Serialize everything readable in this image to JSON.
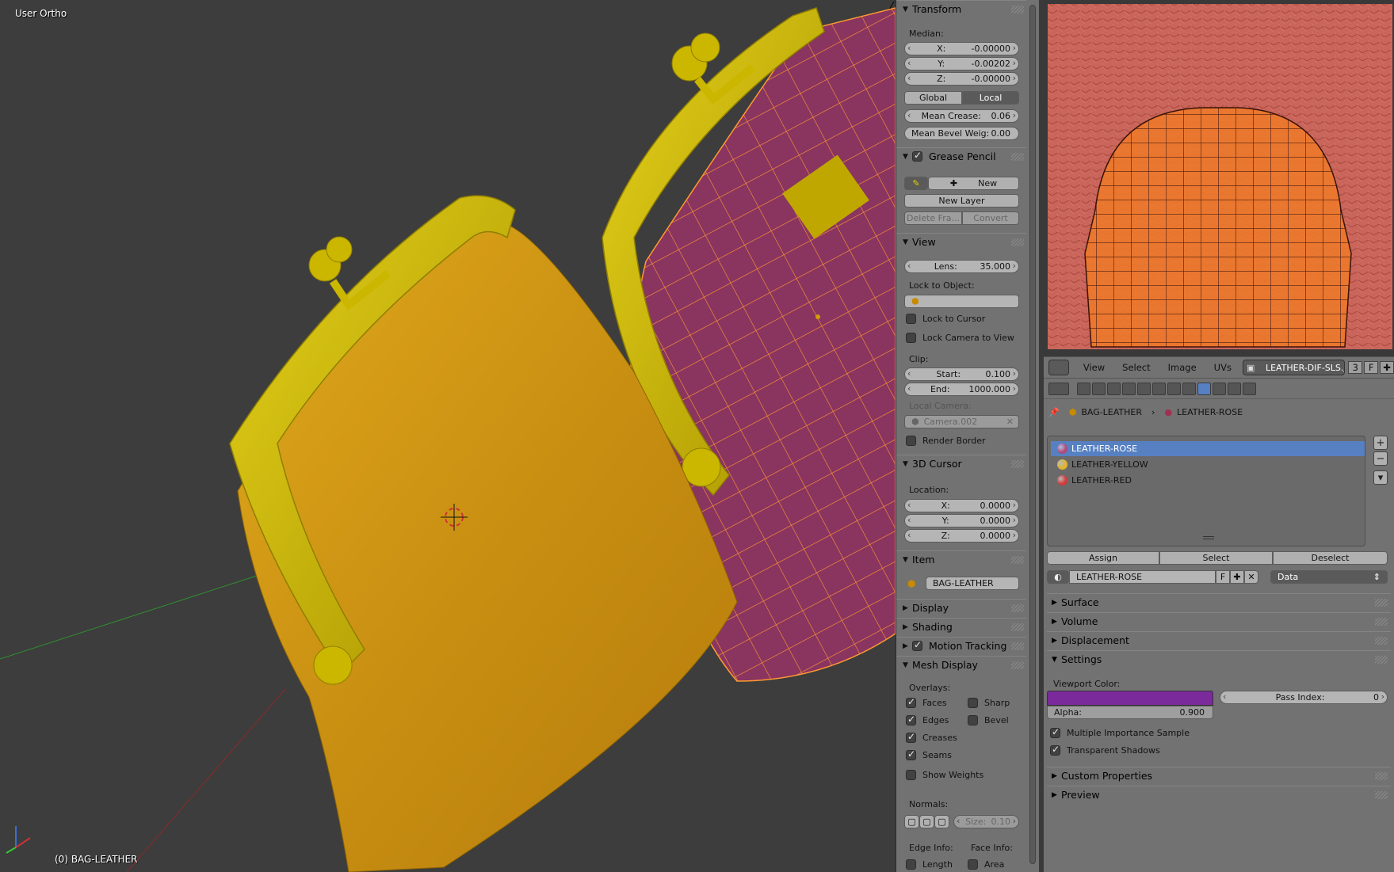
{
  "viewport": {
    "view_label": "User Ortho",
    "active_object_label": "(0) BAG-LEATHER"
  },
  "npanel": {
    "transform": {
      "title": "Transform",
      "median_label": "Median:",
      "x_label": "X:",
      "x_value": "-0.00000",
      "y_label": "Y:",
      "y_value": "-0.00202",
      "z_label": "Z:",
      "z_value": "-0.00000",
      "global_label": "Global",
      "local_label": "Local",
      "mean_crease_label": "Mean Crease:",
      "mean_crease_value": "0.06",
      "mean_bevel_label": "Mean Bevel Weig:",
      "mean_bevel_value": "0.00"
    },
    "grease_pencil": {
      "title": "Grease Pencil",
      "new_label": "New",
      "new_layer_label": "New Layer",
      "delete_frame_label": "Delete Fra...",
      "convert_label": "Convert"
    },
    "view": {
      "title": "View",
      "lens_label": "Lens:",
      "lens_value": "35.000",
      "lock_to_object_label": "Lock to Object:",
      "lock_to_cursor_label": "Lock to Cursor",
      "lock_camera_label": "Lock Camera to View",
      "clip_label": "Clip:",
      "start_label": "Start:",
      "start_value": "0.100",
      "end_label": "End:",
      "end_value": "1000.000",
      "local_camera_label": "Local Camera:",
      "local_camera_value": "Camera.002",
      "render_border_label": "Render Border"
    },
    "cursor": {
      "title": "3D Cursor",
      "location_label": "Location:",
      "x_label": "X:",
      "x_value": "0.0000",
      "y_label": "Y:",
      "y_value": "0.0000",
      "z_label": "Z:",
      "z_value": "0.0000"
    },
    "item": {
      "title": "Item",
      "name_value": "BAG-LEATHER"
    },
    "display_title": "Display",
    "shading_title": "Shading",
    "motion_tracking_title": "Motion Tracking",
    "mesh_display": {
      "title": "Mesh Display",
      "overlays_label": "Overlays:",
      "faces_label": "Faces",
      "sharp_label": "Sharp",
      "edges_label": "Edges",
      "bevel_label": "Bevel",
      "creases_label": "Creases",
      "seams_label": "Seams",
      "show_weights_label": "Show Weights",
      "normals_label": "Normals:",
      "size_label": "Size:",
      "size_value": "0.10",
      "edge_info_label": "Edge Info:",
      "face_info_label": "Face Info:",
      "length_label": "Length",
      "area_label": "Area"
    }
  },
  "image_editor": {
    "menus": [
      "View",
      "Select",
      "Image",
      "UVs"
    ],
    "image_name": "LEATHER-DIF-SLS.j...",
    "users_count": "3",
    "fake_user": "F",
    "texture_color": "#c9655a",
    "uv_color": "#f07a28"
  },
  "properties": {
    "breadcrumb_object": "BAG-LEATHER",
    "breadcrumb_material": "LEATHER-ROSE",
    "material_slots": [
      {
        "name": "LEATHER-ROSE",
        "color": "#b04a7a"
      },
      {
        "name": "LEATHER-YELLOW",
        "color": "#e0b52a"
      },
      {
        "name": "LEATHER-RED",
        "color": "#d03a3a"
      }
    ],
    "assign_label": "Assign",
    "select_label": "Select",
    "deselect_label": "Deselect",
    "material_name": "LEATHER-ROSE",
    "material_fake_user": "F",
    "link_dropdown": "Data",
    "surface_title": "Surface",
    "volume_title": "Volume",
    "displacement_title": "Displacement",
    "settings_title": "Settings",
    "viewport_color_label": "Viewport Color:",
    "viewport_color": "#7a2a9a",
    "pass_index_label": "Pass Index:",
    "pass_index_value": "0",
    "alpha_label": "Alpha:",
    "alpha_value": "0.900",
    "mis_label": "Multiple Importance Sample",
    "transparent_shadows_label": "Transparent Shadows",
    "custom_properties_title": "Custom Properties",
    "preview_title": "Preview"
  },
  "colors": {
    "bag_yellow": "#d4a418",
    "clasp_yellow": "#c8b400",
    "bag_rose": "#8a3460",
    "wire_orange": "#ff9a30",
    "selection_blue": "#5680c2"
  }
}
